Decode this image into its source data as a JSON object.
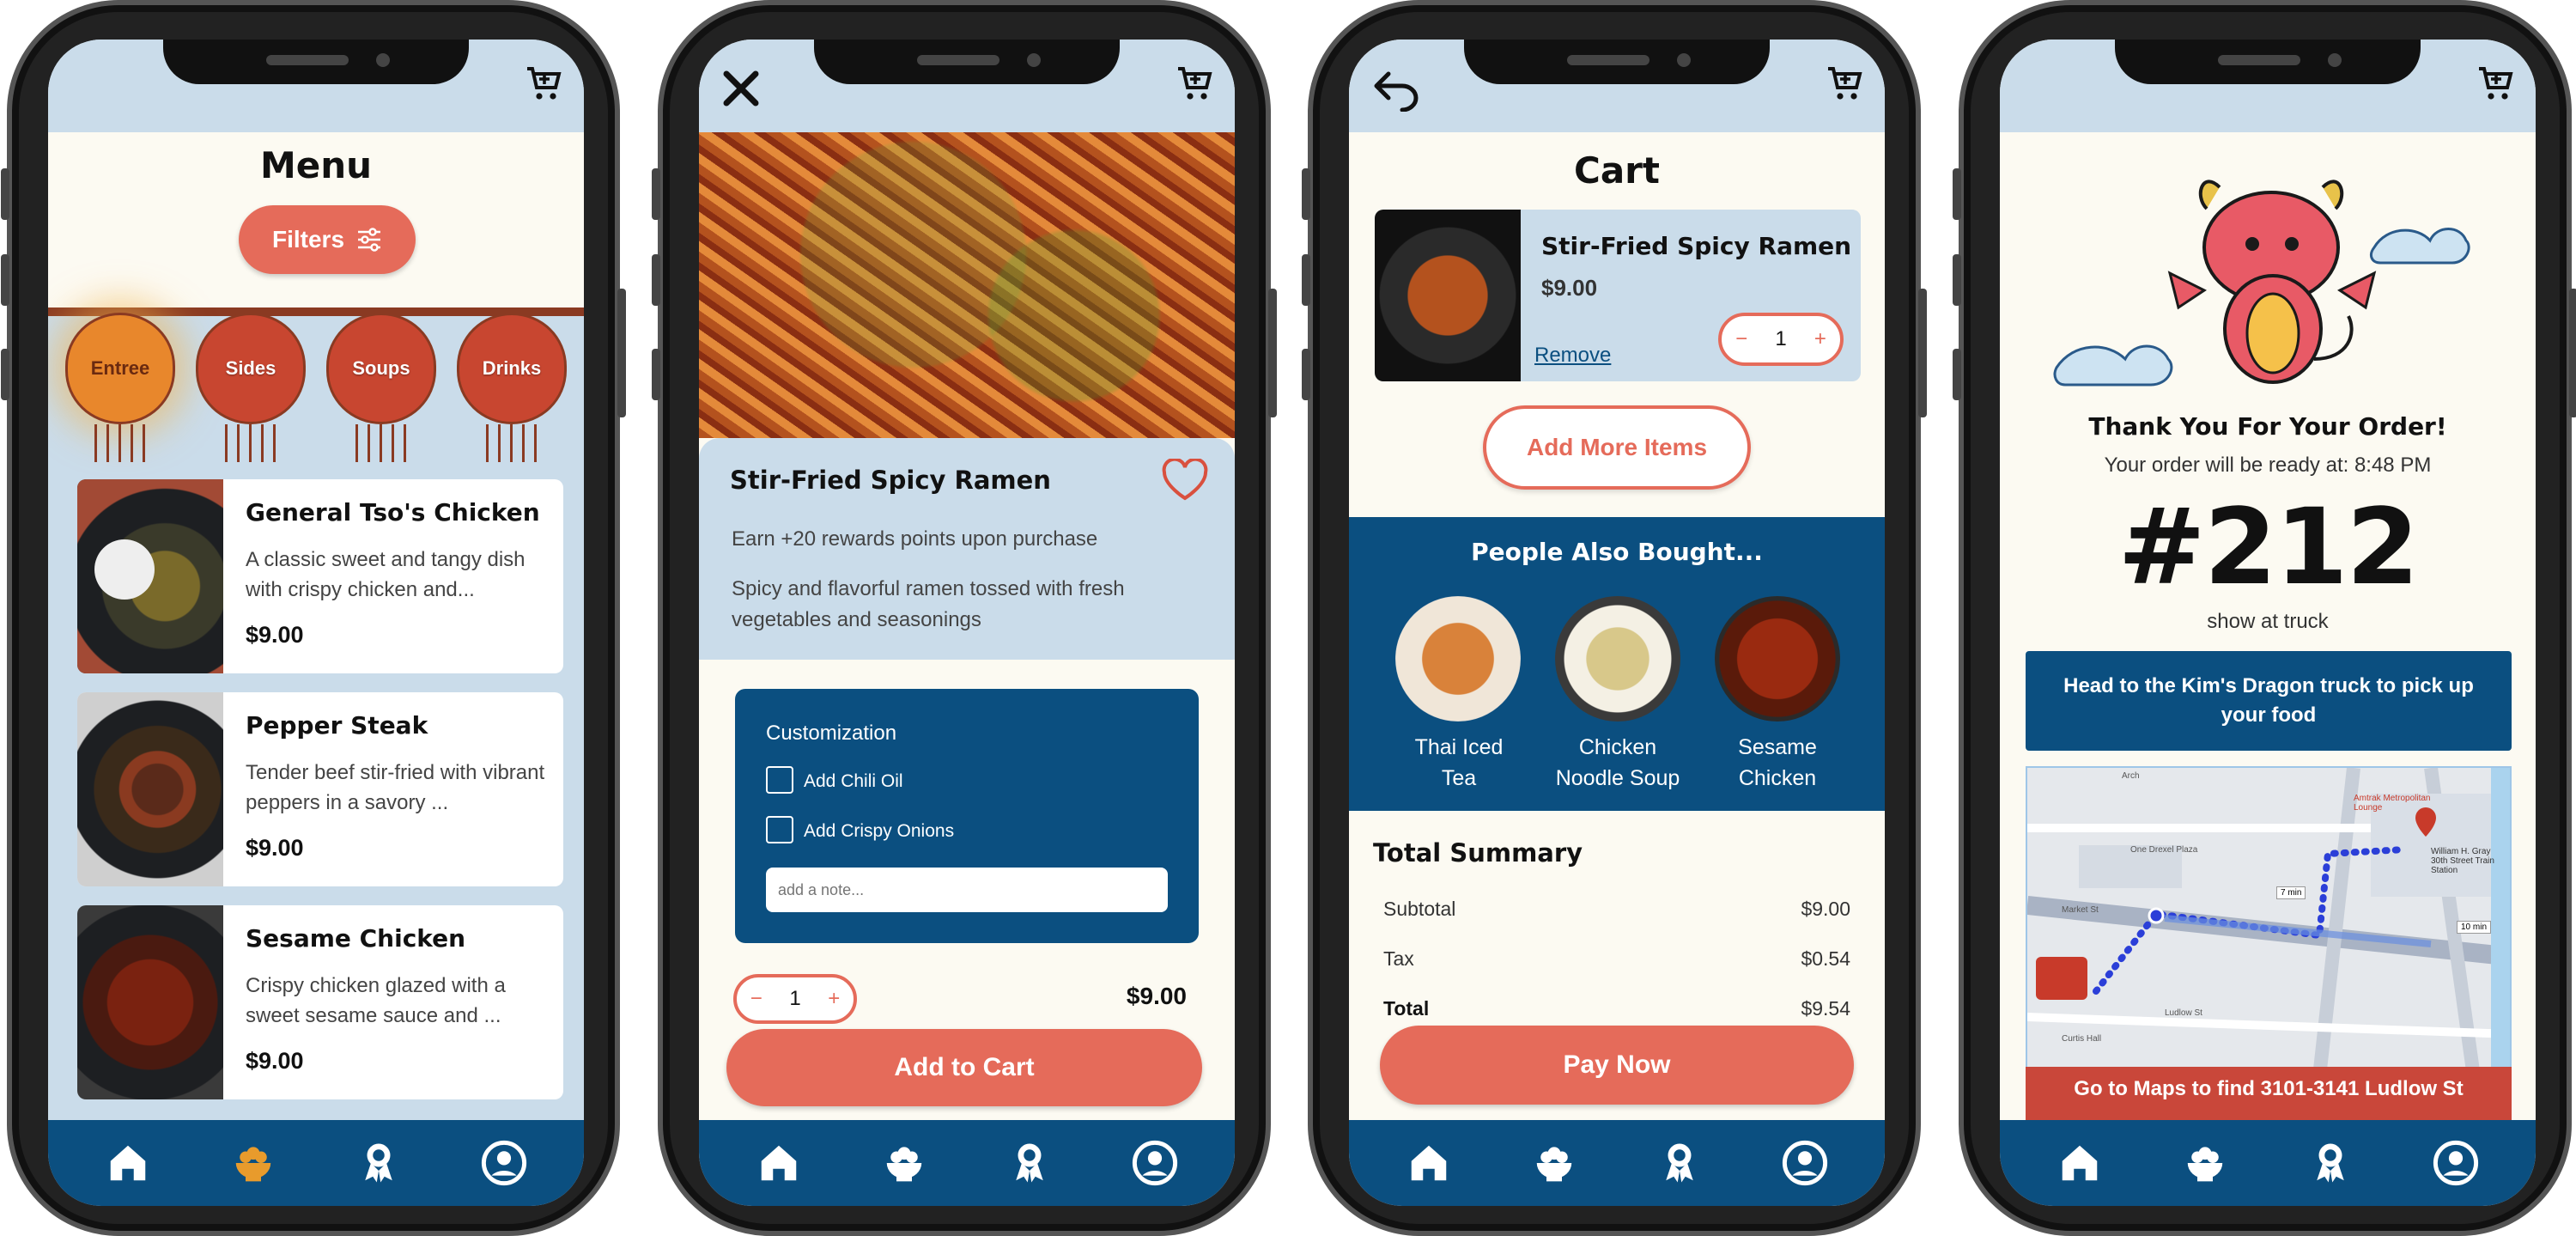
{
  "screen1": {
    "title": "Menu",
    "filters": "Filters",
    "lanterns": [
      "Entree",
      "Sides",
      "Soups",
      "Drinks"
    ],
    "items": [
      {
        "name": "General Tso's Chicken",
        "desc": "A classic sweet and tangy dish with crispy chicken and...",
        "price": "$9.00"
      },
      {
        "name": "Pepper Steak",
        "desc": "Tender beef stir-fried with vibrant peppers in a savory ...",
        "price": "$9.00"
      },
      {
        "name": "Sesame Chicken",
        "desc": "Crispy chicken glazed with a sweet sesame sauce and ...",
        "price": "$9.00"
      }
    ]
  },
  "screen2": {
    "title": "Stir-Fried Spicy Ramen",
    "rewards": "Earn +20 rewards points upon purchase",
    "desc": "Spicy and flavorful ramen tossed with fresh vegetables and seasonings",
    "custom_title": "Customization",
    "opt1": "Add Chili Oil",
    "opt2": "Add Crispy Onions",
    "note_placeholder": "add a note...",
    "qty": "1",
    "minus": "−",
    "plus": "+",
    "price": "$9.00",
    "add": "Add to Cart"
  },
  "screen3": {
    "title": "Cart",
    "item": "Stir-Fried Spicy Ramen",
    "price": "$9.00",
    "remove": "Remove",
    "qty": "1",
    "minus": "−",
    "plus": "+",
    "add_more": "Add More Items",
    "also": "People Also Bought...",
    "suggestions": [
      {
        "l1": "Thai Iced",
        "l2": "Tea"
      },
      {
        "l1": "Chicken",
        "l2": "Noodle Soup"
      },
      {
        "l1": "Sesame",
        "l2": "Chicken"
      }
    ],
    "summary": "Total Summary",
    "subtotal_l": "Subtotal",
    "subtotal_v": "$9.00",
    "tax_l": "Tax",
    "tax_v": "$0.54",
    "total_l": "Total",
    "total_v": "$9.54",
    "pay": "Pay Now"
  },
  "screen4": {
    "thanks": "Thank You For Your Order!",
    "ready": "Your order will be ready at: 8:48 PM",
    "number": "#212",
    "show": "show at truck",
    "head": "Head to the Kim's Dragon truck to pick up your food",
    "maps": "Go to Maps to find 3101-3141 Ludlow St",
    "map_labels": {
      "station": "William H. Gray 30th Street Train Station",
      "time1": "7 min",
      "time2": "10 min",
      "market": "Market St",
      "ludlow": "Ludlow St",
      "lounge": "Amtrak Metropolitan Lounge",
      "one_drexel": "One Drexel Plaza",
      "curtis": "Curtis Hall",
      "arch": "Arch"
    }
  },
  "colors": {
    "navy": "#0b4f80",
    "coral": "#e56b5a",
    "lightblue": "#cadcea",
    "cream": "#fcfaf2",
    "active": "#e89b2c"
  },
  "icons": [
    "cart-icon",
    "home-icon",
    "bowl-icon",
    "rewards-icon",
    "profile-icon",
    "close-icon",
    "back-icon",
    "heart-icon",
    "filter-icon"
  ]
}
